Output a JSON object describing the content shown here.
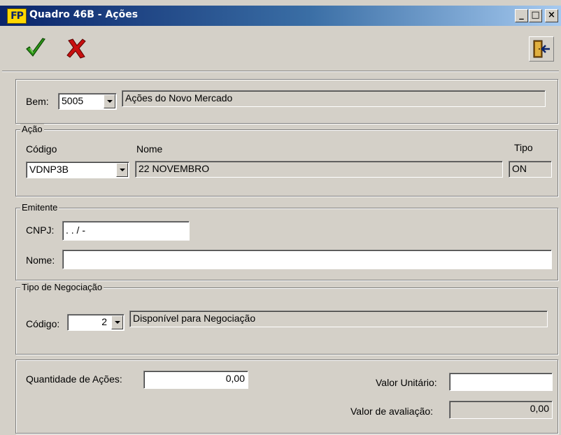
{
  "window": {
    "title": "Quadro 46B - Ações",
    "app_icon": "FP",
    "minimize_glyph": "_",
    "maximize_glyph": "□",
    "close_glyph": "×"
  },
  "toolbar": {
    "confirm_icon": "green-check-icon",
    "cancel_icon": "red-x-icon",
    "exit_icon": "exit-door-icon"
  },
  "bem": {
    "label": "Bem:",
    "code": "5005",
    "description": "Ações do Novo Mercado"
  },
  "acao": {
    "legend": "Ação",
    "codigo_label": "Código",
    "codigo_value": "VDNP3B",
    "nome_label": "Nome",
    "nome_value": "22 NOVEMBRO",
    "tipo_label": "Tipo",
    "tipo_value": "ON"
  },
  "emitente": {
    "legend": "Emitente",
    "cnpj_label": "CNPJ:",
    "cnpj_mask": " .   .   /   -",
    "nome_label": "Nome:",
    "nome_value": ""
  },
  "negociacao": {
    "legend": "Tipo de Negociação",
    "codigo_label": "Código:",
    "codigo_value": "2",
    "description": "Disponível para Negociação"
  },
  "valores": {
    "quantidade_label": "Quantidade de Ações:",
    "quantidade_value": "0,00",
    "valor_unitario_label": "Valor Unitário:",
    "valor_unitario_value": "",
    "valor_avaliacao_label": "Valor de avaliação:",
    "valor_avaliacao_value": "0,00"
  },
  "colors": {
    "face": "#d4d0c8",
    "title_start": "#0a246a",
    "title_end": "#a6caf0",
    "check_green": "#2e9a18",
    "cancel_red": "#c81010"
  }
}
